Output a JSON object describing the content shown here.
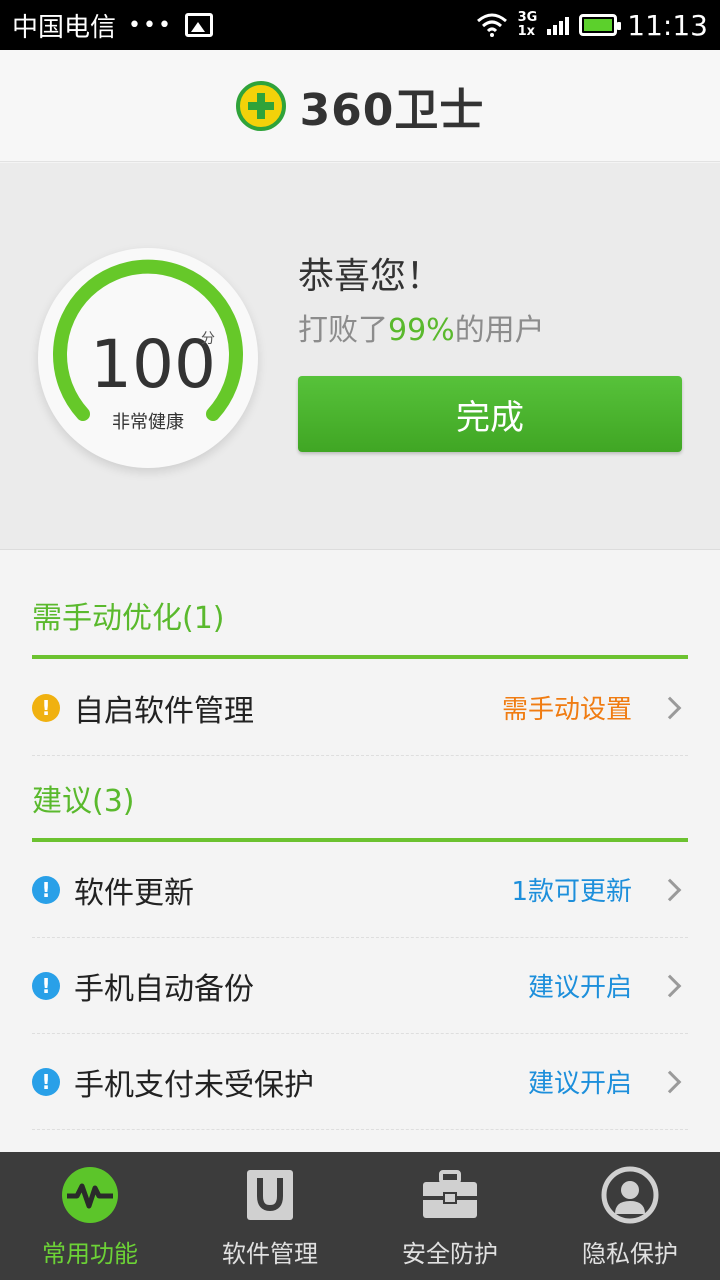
{
  "status_bar": {
    "carrier": "中国电信",
    "dots": "•••",
    "net_top": "3G",
    "net_bottom": "1x",
    "time": "11:13"
  },
  "header": {
    "logo_text": "360卫士"
  },
  "score_panel": {
    "score": "100",
    "unit": "分",
    "health_status": "非常健康",
    "congrats": "恭喜您！",
    "beat_prefix": "打败了",
    "beat_percent": "99%",
    "beat_suffix": "的用户",
    "done_label": "完成"
  },
  "sections": {
    "manual": {
      "title": "需手动优化(1)",
      "items": [
        {
          "label": "自启软件管理",
          "status": "需手动设置"
        }
      ]
    },
    "suggest": {
      "title": "建议(3)",
      "items": [
        {
          "label": "软件更新",
          "status": "1款可更新"
        },
        {
          "label": "手机自动备份",
          "status": "建议开启"
        },
        {
          "label": "手机支付未受保护",
          "status": "建议开启"
        }
      ]
    }
  },
  "bottom_nav": [
    {
      "label": "常用功能",
      "icon": "pulse-icon",
      "active": true
    },
    {
      "label": "软件管理",
      "icon": "shopping-bag-icon"
    },
    {
      "label": "安全防护",
      "icon": "toolbox-icon"
    },
    {
      "label": "隐私保护",
      "icon": "user-shield-icon"
    }
  ],
  "colors": {
    "accent_green": "#5ab92d",
    "warning_orange": "#f07c12",
    "info_blue": "#1d8fdb"
  }
}
